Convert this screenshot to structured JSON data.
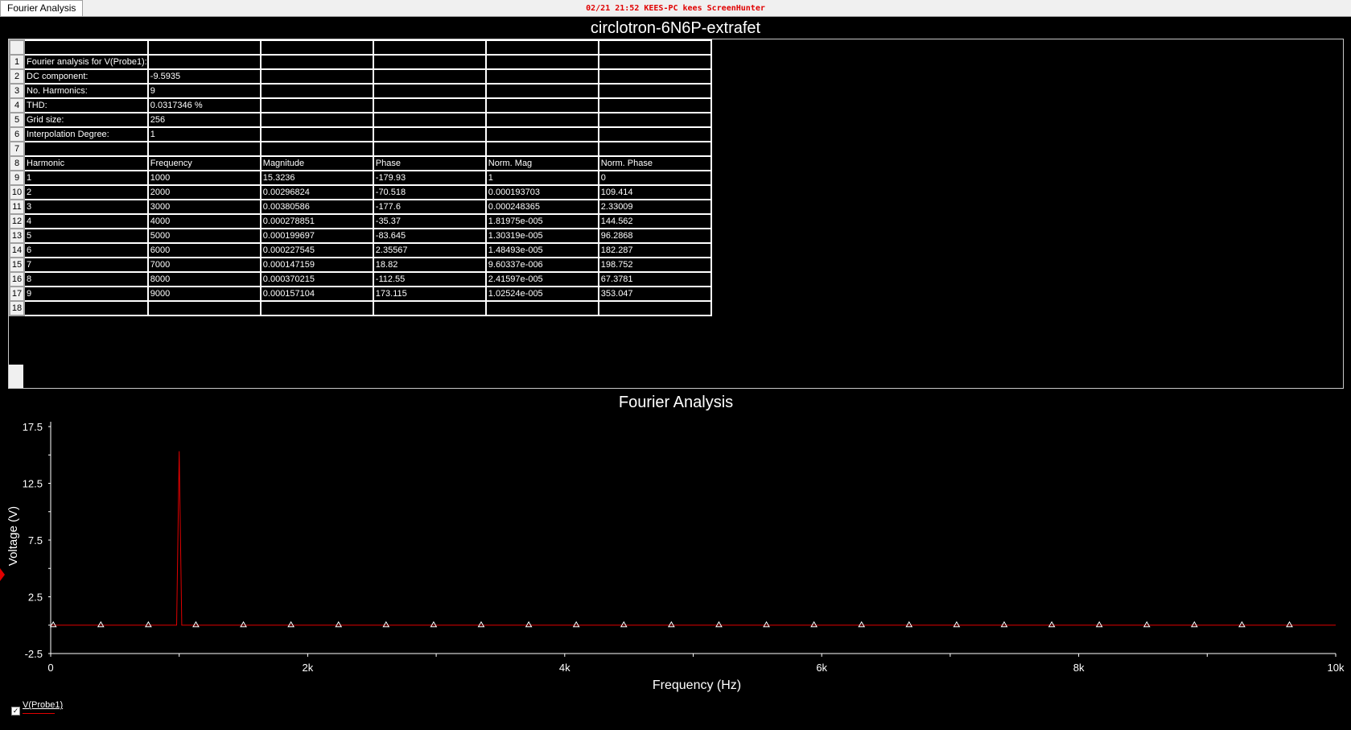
{
  "tab": {
    "label": "Fourier Analysis"
  },
  "watermark": "02/21  21:52  KEES-PC  kees  ScreenHunter",
  "sheet": {
    "title": "circlotron-6N6P-extrafet",
    "rows": [
      [
        "1",
        "Fourier analysis for V(Probe1):",
        "",
        "",
        "",
        "",
        ""
      ],
      [
        "2",
        "DC component:",
        "-9.5935",
        "",
        "",
        "",
        ""
      ],
      [
        "3",
        "No. Harmonics:",
        "9",
        "",
        "",
        "",
        ""
      ],
      [
        "4",
        "THD:",
        "0.0317346 %",
        "",
        "",
        "",
        ""
      ],
      [
        "5",
        "Grid size:",
        "256",
        "",
        "",
        "",
        ""
      ],
      [
        "6",
        "Interpolation Degree:",
        "1",
        "",
        "",
        "",
        ""
      ],
      [
        "7",
        "",
        "",
        "",
        "",
        "",
        ""
      ],
      [
        "8",
        "Harmonic",
        "Frequency",
        "Magnitude",
        "Phase",
        "Norm. Mag",
        "Norm. Phase"
      ],
      [
        "9",
        "1",
        "1000",
        "15.3236",
        "-179.93",
        "1",
        "0"
      ],
      [
        "10",
        "2",
        "2000",
        "0.00296824",
        "-70.518",
        "0.000193703",
        "109.414"
      ],
      [
        "11",
        "3",
        "3000",
        "0.00380586",
        "-177.6",
        "0.000248365",
        "2.33009"
      ],
      [
        "12",
        "4",
        "4000",
        "0.000278851",
        "-35.37",
        "1.81975e-005",
        "144.562"
      ],
      [
        "13",
        "5",
        "5000",
        "0.000199697",
        "-83.645",
        "1.30319e-005",
        "96.2868"
      ],
      [
        "14",
        "6",
        "6000",
        "0.000227545",
        "2.35567",
        "1.48493e-005",
        "182.287"
      ],
      [
        "15",
        "7",
        "7000",
        "0.000147159",
        "18.82",
        "9.60337e-006",
        "198.752"
      ],
      [
        "16",
        "8",
        "8000",
        "0.000370215",
        "-112.55",
        "2.41597e-005",
        "67.3781"
      ],
      [
        "17",
        "9",
        "9000",
        "0.000157104",
        "173.115",
        "1.02524e-005",
        "353.047"
      ],
      [
        "18",
        "",
        "",
        "",
        "",
        "",
        ""
      ]
    ]
  },
  "chart_data": {
    "type": "line",
    "title": "Fourier Analysis",
    "xlabel": "Frequency (Hz)",
    "ylabel": "Voltage (V)",
    "xlim": [
      0,
      10000
    ],
    "ylim": [
      -2.5,
      17.5
    ],
    "x_ticks": [
      {
        "value": 0,
        "label": "0"
      },
      {
        "value": 2000,
        "label": "2k"
      },
      {
        "value": 4000,
        "label": "4k"
      },
      {
        "value": 6000,
        "label": "6k"
      },
      {
        "value": 8000,
        "label": "8k"
      },
      {
        "value": 10000,
        "label": "10k"
      }
    ],
    "y_ticks": [
      {
        "value": -2.5,
        "label": "-2.5"
      },
      {
        "value": 2.5,
        "label": "2.5"
      },
      {
        "value": 7.5,
        "label": "7.5"
      },
      {
        "value": 12.5,
        "label": "12.5"
      },
      {
        "value": 17.5,
        "label": "17.5"
      }
    ],
    "series": [
      {
        "name": "V(Probe1)",
        "color": "#e00000",
        "x": [
          0,
          980,
          1000,
          1020,
          10000
        ],
        "y": [
          0,
          0,
          15.3236,
          0,
          0
        ],
        "marker": "triangle",
        "marker_x": [
          20,
          390,
          760,
          1130,
          1500,
          1870,
          2240,
          2610,
          2980,
          3350,
          3720,
          4090,
          4460,
          4830,
          5200,
          5570,
          5940,
          6310,
          6680,
          7050,
          7420,
          7790,
          8160,
          8530,
          8900,
          9270,
          9640
        ]
      }
    ],
    "grid": false,
    "legend": "bottom-left"
  },
  "colors": {
    "background": "#000000",
    "trace": "#e00000",
    "text": "#ffffff"
  }
}
